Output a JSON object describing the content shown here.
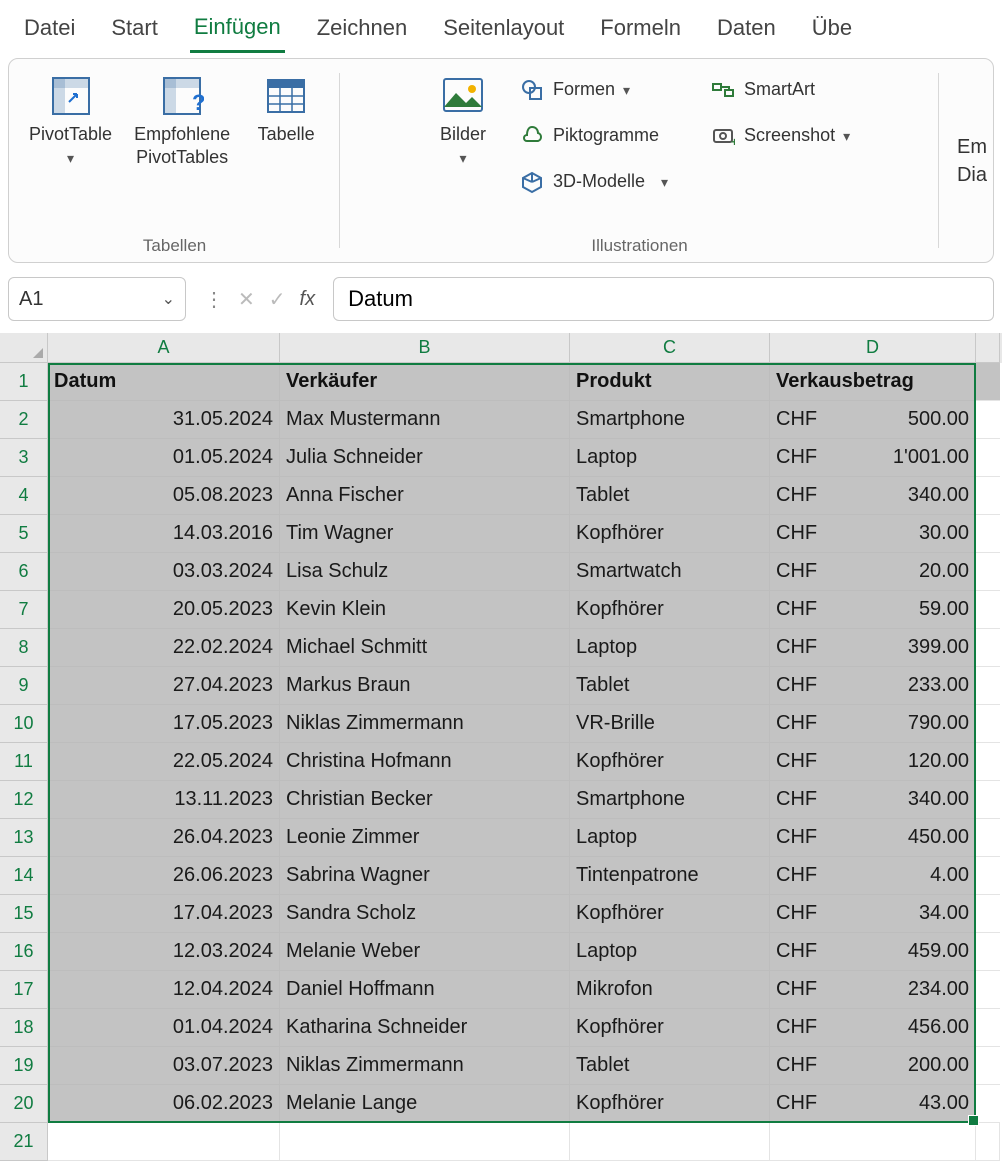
{
  "menu": {
    "items": [
      "Datei",
      "Start",
      "Einfügen",
      "Zeichnen",
      "Seitenlayout",
      "Formeln",
      "Daten",
      "Übe"
    ],
    "active_index": 2
  },
  "ribbon": {
    "tabellen": {
      "label": "Tabellen",
      "pivot": "PivotTable",
      "pivot_rec": "Empfohlene\nPivotTables",
      "tabelle": "Tabelle"
    },
    "illus": {
      "label": "Illustrationen",
      "bilder": "Bilder",
      "formen": "Formen",
      "pikto": "Piktogramme",
      "models": "3D-Modelle",
      "smartart": "SmartArt",
      "screenshot": "Screenshot"
    },
    "truncated": {
      "line1": "Em",
      "line2": "Dia"
    }
  },
  "formula_bar": {
    "namebox": "A1",
    "fx": "fx",
    "value": "Datum"
  },
  "sheet": {
    "columns": [
      "A",
      "B",
      "C",
      "D"
    ],
    "row_count": 21,
    "headers": [
      "Datum",
      "Verkäufer",
      "Produkt",
      "Verkausbetrag"
    ],
    "currency": "CHF",
    "rows": [
      {
        "date": "31.05.2024",
        "seller": "Max Mustermann",
        "product": "Smartphone",
        "amount": "500.00"
      },
      {
        "date": "01.05.2024",
        "seller": "Julia Schneider",
        "product": "Laptop",
        "amount": "1'001.00"
      },
      {
        "date": "05.08.2023",
        "seller": "Anna Fischer",
        "product": "Tablet",
        "amount": "340.00"
      },
      {
        "date": "14.03.2016",
        "seller": "Tim Wagner",
        "product": "Kopfhörer",
        "amount": "30.00"
      },
      {
        "date": "03.03.2024",
        "seller": "Lisa Schulz",
        "product": "Smartwatch",
        "amount": "20.00"
      },
      {
        "date": "20.05.2023",
        "seller": "Kevin Klein",
        "product": "Kopfhörer",
        "amount": "59.00"
      },
      {
        "date": "22.02.2024",
        "seller": "Michael Schmitt",
        "product": "Laptop",
        "amount": "399.00"
      },
      {
        "date": "27.04.2023",
        "seller": "Markus Braun",
        "product": "Tablet",
        "amount": "233.00"
      },
      {
        "date": "17.05.2023",
        "seller": "Niklas Zimmermann",
        "product": "VR-Brille",
        "amount": "790.00"
      },
      {
        "date": "22.05.2024",
        "seller": "Christina Hofmann",
        "product": "Kopfhörer",
        "amount": "120.00"
      },
      {
        "date": "13.11.2023",
        "seller": "Christian Becker",
        "product": "Smartphone",
        "amount": "340.00"
      },
      {
        "date": "26.04.2023",
        "seller": "Leonie Zimmer",
        "product": "Laptop",
        "amount": "450.00"
      },
      {
        "date": "26.06.2023",
        "seller": "Sabrina Wagner",
        "product": "Tintenpatrone",
        "amount": "4.00"
      },
      {
        "date": "17.04.2023",
        "seller": "Sandra Scholz",
        "product": "Kopfhörer",
        "amount": "34.00"
      },
      {
        "date": "12.03.2024",
        "seller": "Melanie Weber",
        "product": "Laptop",
        "amount": "459.00"
      },
      {
        "date": "12.04.2024",
        "seller": "Daniel Hoffmann",
        "product": "Mikrofon",
        "amount": "234.00"
      },
      {
        "date": "01.04.2024",
        "seller": "Katharina Schneider",
        "product": "Kopfhörer",
        "amount": "456.00"
      },
      {
        "date": "03.07.2023",
        "seller": "Niklas Zimmermann",
        "product": "Tablet",
        "amount": "200.00"
      },
      {
        "date": "06.02.2023",
        "seller": "Melanie Lange",
        "product": "Kopfhörer",
        "amount": "43.00"
      }
    ]
  }
}
